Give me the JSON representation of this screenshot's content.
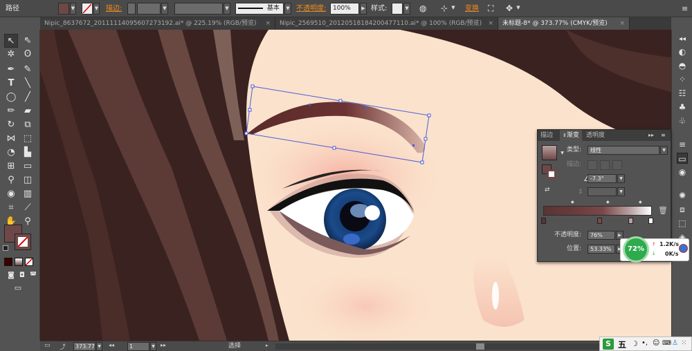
{
  "control_bar": {
    "object_label": "路径",
    "stroke_label": "描边:",
    "brush_value": "基本",
    "opacity_label": "不透明度:",
    "opacity_value": "100%",
    "style_label": "样式:",
    "transform_label": "变换",
    "fill_color": "#6e4848",
    "accent_color": "#f08c1e"
  },
  "tabs": [
    {
      "label": "Nipic_8637672_20111114095607273192.ai* @ 225.19% (RGB/预览)",
      "close": "×"
    },
    {
      "label": "Nipic_2569510_20120518184200477110.ai* @ 100% (RGB/预览)",
      "close": "×"
    },
    {
      "label": "未标题-8* @ 373.77% (CMYK/预览)",
      "close": "×"
    }
  ],
  "gradient_panel": {
    "tabs": [
      "描边",
      "渐变",
      "透明度"
    ],
    "type_label": "类型:",
    "type_value": "线性",
    "stroke_label": "描边:",
    "angle_value": "-7.3°",
    "opacity_label": "不透明度:",
    "opacity_value": "76%",
    "position_label": "位置:",
    "position_value": "53.33%"
  },
  "speed_widget": {
    "percent": "72%",
    "upload": "1.2K/s",
    "download": "0K/s"
  },
  "status_bar": {
    "zoom_value": "373.77",
    "page_value": "1",
    "tool_status": "选择"
  },
  "ime_bar": {
    "mode_char": "五"
  }
}
